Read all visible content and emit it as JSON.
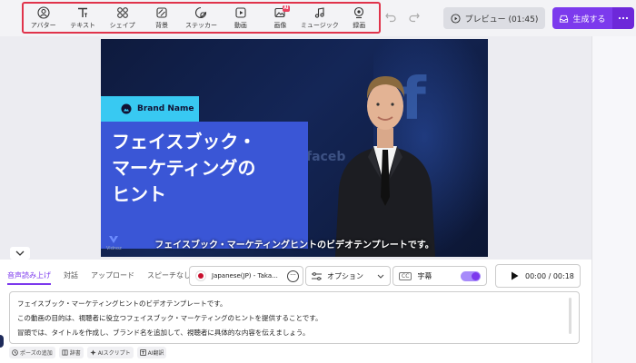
{
  "toolbar": {
    "tools": [
      {
        "label": "アバター",
        "icon": "avatar-icon"
      },
      {
        "label": "テキスト",
        "icon": "text-icon"
      },
      {
        "label": "シェイプ",
        "icon": "shape-icon"
      },
      {
        "label": "背景",
        "icon": "background-icon"
      },
      {
        "label": "ステッカー",
        "icon": "sticker-icon"
      },
      {
        "label": "動画",
        "icon": "video-icon"
      },
      {
        "label": "画像",
        "icon": "image-icon",
        "badge": "AI"
      },
      {
        "label": "ミュージック",
        "icon": "music-icon"
      },
      {
        "label": "録画",
        "icon": "record-icon"
      }
    ],
    "preview_label": "プレビュー (01:45)",
    "generate_label": "生成する"
  },
  "canvas": {
    "brand_name": "Brand Name",
    "title_lines": [
      "フェイスブック・",
      "マーケティングの",
      "ヒント"
    ],
    "subtitle": "フェイスブック・マーケティングヒントのビデオテンプレートです。",
    "watermark": "Vidnoz"
  },
  "editor": {
    "tabs": [
      "音声読み上げ",
      "対話",
      "アップロード",
      "スピーチなし"
    ],
    "active_tab": "音声読み上げ",
    "voice": "Japanese(JP) - Taka...",
    "options_label": "オプション",
    "subtitle_label": "字幕",
    "subtitle_cc": "CC",
    "subtitle_enabled": true,
    "time": "00:00 / 00:18",
    "script_lines": [
      "フェイスブック・マーケティングヒントのビデオテンプレートです。",
      "この動画の目的は、視聴者に役立つフェイスブック・マーケティングのヒントを提供することです。",
      "冒頭では、タイトルを作成し、ブランド名を追加して、視聴者に具体的な内容を伝えましょう。"
    ],
    "chips": [
      "ポーズの追加",
      "辞書",
      "AIスクリプト",
      "AI翻訳"
    ]
  },
  "colors": {
    "accent": "#7c3aed",
    "highlight_border": "#e0334b",
    "brand_tag": "#38c9f2",
    "title_box": "#3a56d6"
  }
}
